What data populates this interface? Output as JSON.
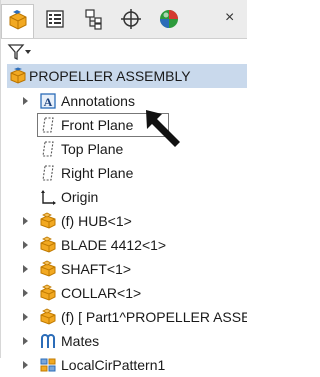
{
  "tabs": [
    {
      "name": "featuremanager-tab",
      "active": true
    },
    {
      "name": "propertymanager-tab",
      "active": false
    },
    {
      "name": "configurationmanager-tab",
      "active": false
    },
    {
      "name": "dimxpertmanager-tab",
      "active": false
    },
    {
      "name": "displaymanager-tab",
      "active": false
    }
  ],
  "close_glyph": "×",
  "tree": {
    "root": "PROPELLER ASSEMBLY",
    "items": [
      {
        "label": "Annotations",
        "icon": "annotations-icon",
        "expandable": true
      },
      {
        "label": "Front Plane",
        "icon": "plane-icon",
        "expandable": false
      },
      {
        "label": "Top Plane",
        "icon": "plane-icon",
        "expandable": false
      },
      {
        "label": "Right Plane",
        "icon": "plane-icon",
        "expandable": false
      },
      {
        "label": "Origin",
        "icon": "origin-icon",
        "expandable": false
      },
      {
        "label": "(f) HUB<1>",
        "icon": "part-icon",
        "expandable": true
      },
      {
        "label": "BLADE 4412<1>",
        "icon": "part-icon",
        "expandable": true
      },
      {
        "label": "SHAFT<1>",
        "icon": "part-icon",
        "expandable": true
      },
      {
        "label": "COLLAR<1>",
        "icon": "part-icon",
        "expandable": true
      },
      {
        "label": "(f) [ Part1^PROPELLER ASSE",
        "icon": "part-icon",
        "expandable": true
      },
      {
        "label": "Mates",
        "icon": "mates-icon",
        "expandable": true
      },
      {
        "label": "LocalCirPattern1",
        "icon": "pattern-icon",
        "expandable": true
      }
    ]
  },
  "colors": {
    "part": "#f2a922",
    "root_highlight": "#c9d9ec",
    "icon_blue": "#2b6cb8"
  }
}
